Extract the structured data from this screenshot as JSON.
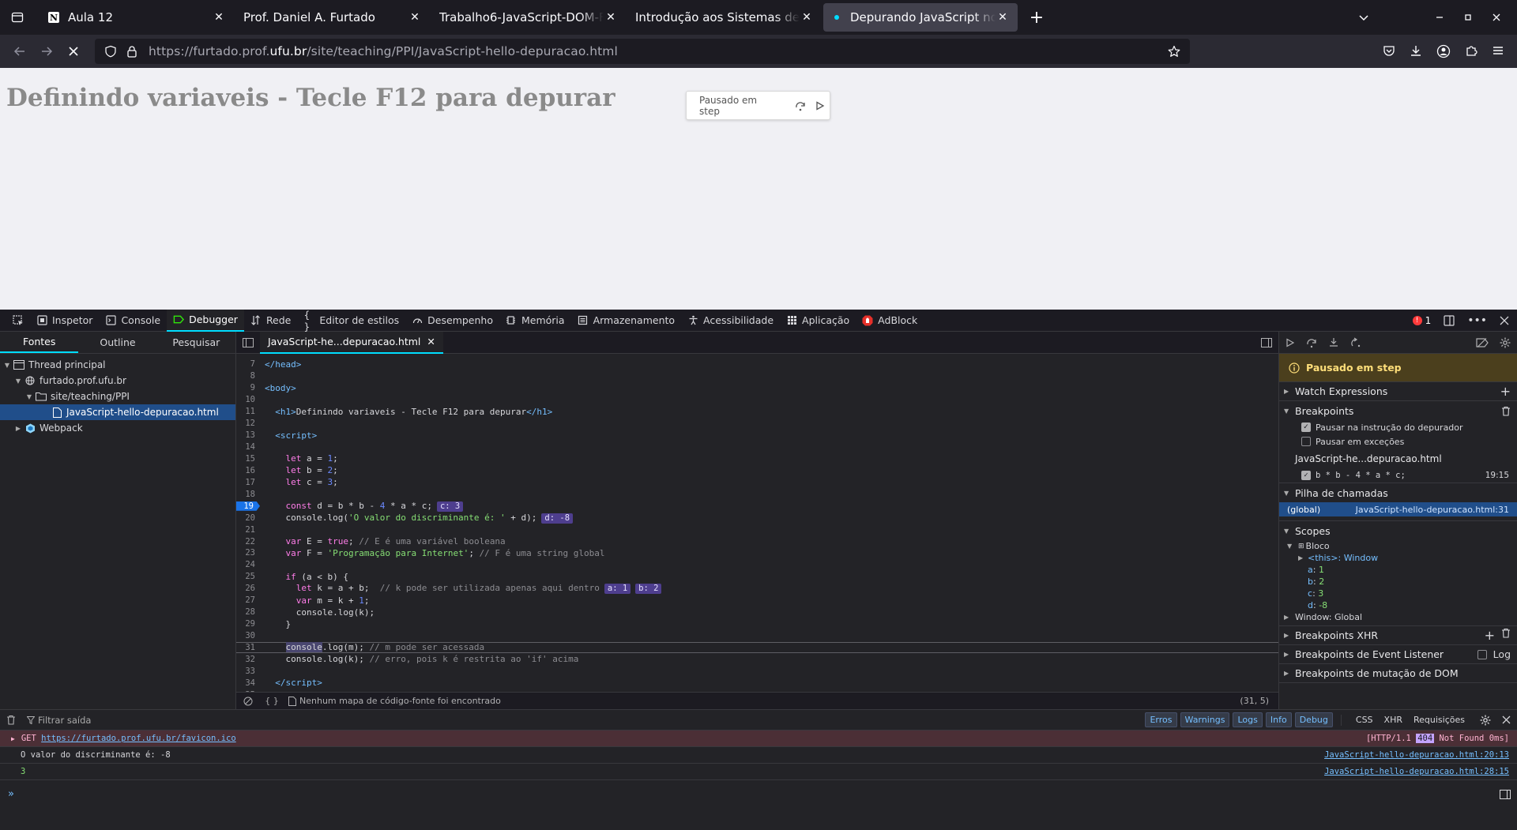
{
  "tabs": [
    {
      "title": "Aula 12",
      "favicon": "notion-icon"
    },
    {
      "title": "Prof. Daniel A. Furtado",
      "favicon": "none"
    },
    {
      "title": "Trabalho6-JavaScript-DOM-Fetch",
      "favicon": "none"
    },
    {
      "title": "Introdução aos Sistemas de Informação",
      "favicon": "none"
    },
    {
      "title": "Depurando JavaScript no Firefox",
      "favicon": "loading-dot",
      "active": true
    }
  ],
  "address": {
    "prefix": "https://furtado.prof.",
    "domain": "ufu.br",
    "path": "/site/teaching/PPI/JavaScript-hello-depuracao.html"
  },
  "page": {
    "heading": "Definindo variaveis - Tecle F12 para depurar",
    "pause_label": "Pausado em step"
  },
  "devtools": {
    "tabs": [
      "Inspetor",
      "Console",
      "Debugger",
      "Rede",
      "Editor de estilos",
      "Desempenho",
      "Memória",
      "Armazenamento",
      "Acessibilidade",
      "Aplicação",
      "AdBlock"
    ],
    "active_tab": "Debugger",
    "error_count": "1",
    "sources_tabs": [
      "Fontes",
      "Outline",
      "Pesquisar"
    ],
    "tree": {
      "thread": "Thread principal",
      "domain": "furtado.prof.ufu.br",
      "folder": "site/teaching/PPI",
      "file": "JavaScript-hello-depuracao.html",
      "webpack": "Webpack"
    },
    "editor_tab": "JavaScript-he...depuracao.html",
    "footer": {
      "sourcemap": "Nenhum mapa de código-fonte foi encontrado",
      "cursor": "(31, 5)"
    },
    "panel": {
      "paused": "Pausado em step",
      "watch": "Watch Expressions",
      "breakpoints": "Breakpoints",
      "pause_on_debugger": "Pausar na instrução do depurador",
      "pause_on_exceptions": "Pausar em exceções",
      "bp_file": "JavaScript-he...depuracao.html",
      "bp_code": "b * b - 4 * a * c;",
      "bp_line": "19:15",
      "callstack": "Pilha de chamadas",
      "frame_name": "(global)",
      "frame_loc": "JavaScript-hello-depuracao.html:31",
      "scopes": "Scopes",
      "block": "Bloco",
      "this": "<this>: Window",
      "vars": [
        {
          "k": "a",
          "v": "1"
        },
        {
          "k": "b",
          "v": "2"
        },
        {
          "k": "c",
          "v": "3"
        },
        {
          "k": "d",
          "v": "-8"
        }
      ],
      "window_global": "Window: Global",
      "xhr": "Breakpoints XHR",
      "event": "Breakpoints de Event Listener",
      "log": "Log",
      "dom": "Breakpoints de mutação de DOM"
    },
    "console": {
      "filter_placeholder": "Filtrar saída",
      "filters": [
        "Erros",
        "Warnings",
        "Logs",
        "Info",
        "Debug"
      ],
      "extra_filters": [
        "CSS",
        "XHR",
        "Requisições"
      ],
      "rows": [
        {
          "method": "GET",
          "url": "https://furtado.prof.ufu.br/favicon.ico",
          "status_pre": "[HTTP/1.1",
          "status_code": "404",
          "status_post": "Not Found 0ms]"
        },
        {
          "msg": "O valor do discriminante é: -8",
          "src": "JavaScript-hello-depuracao.html:20:13"
        },
        {
          "msg": "3",
          "src": "JavaScript-hello-depuracao.html:28:15"
        }
      ]
    }
  }
}
